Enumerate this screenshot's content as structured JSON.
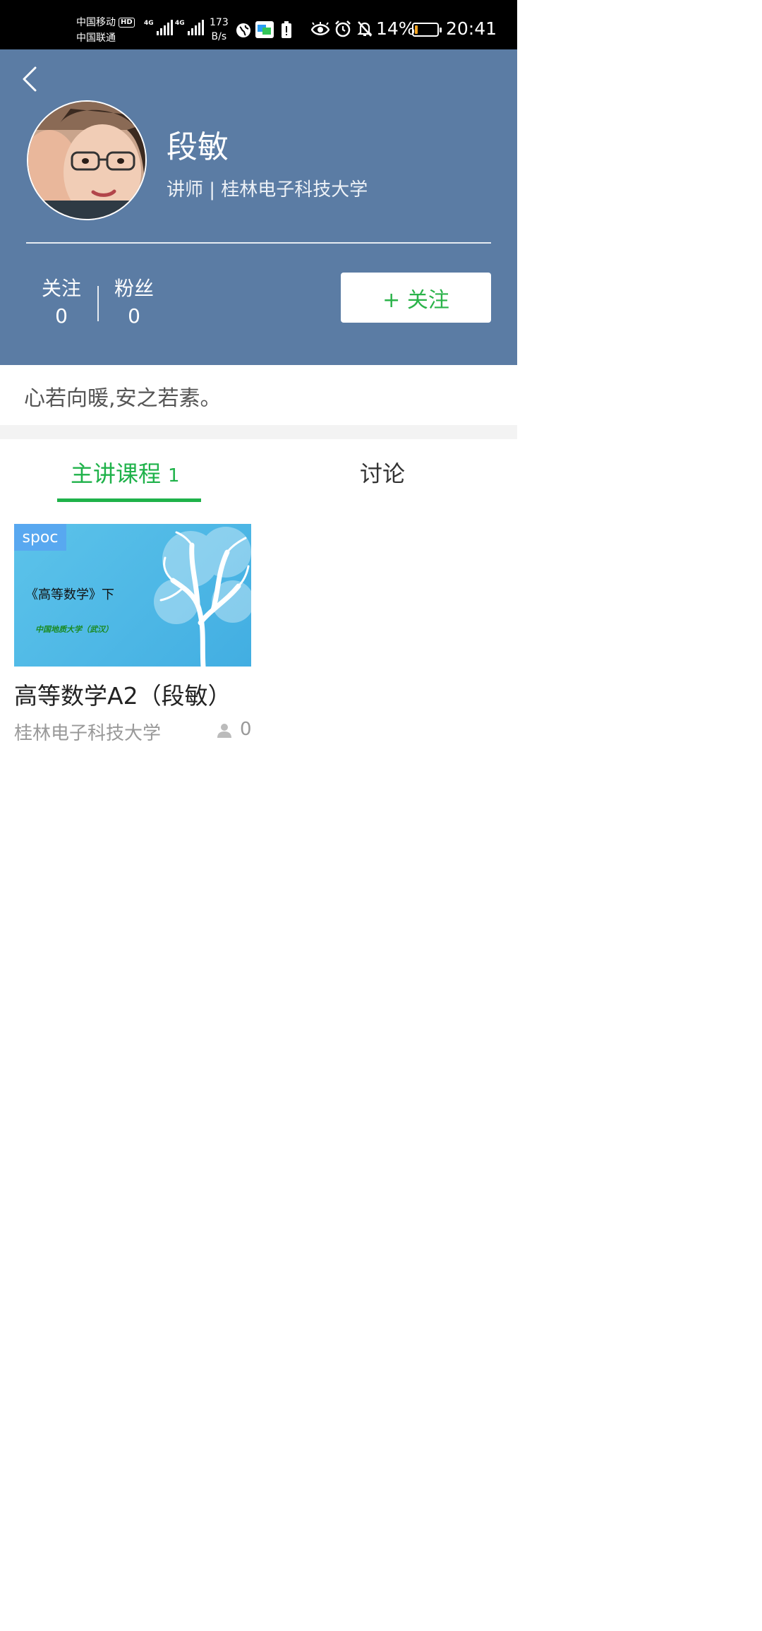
{
  "status_bar": {
    "carrier_1": "中国移动",
    "hd_badge": "HD",
    "carrier_2": "中国联通",
    "network_1": "4G",
    "network_2": "4G",
    "speed_value": "173",
    "speed_unit": "B/s",
    "battery_percent": "14%",
    "battery_level": 0.14,
    "time": "20:41",
    "icons": [
      "globe-icon",
      "news-app-icon",
      "battery-alert-icon",
      "eye-icon",
      "alarm-icon",
      "bell-off-icon"
    ]
  },
  "header": {
    "back_icon": "chevron-left-icon",
    "name": "段敏",
    "subtitle": "讲师 | 桂林电子科技大学",
    "stats": {
      "following_label": "关注",
      "following_count": "0",
      "fans_label": "粉丝",
      "fans_count": "0"
    },
    "follow_button_label": "+ 关注"
  },
  "motto": "心若向暖,安之若素。",
  "tabs": {
    "courses_label": "主讲课程",
    "courses_count": "1",
    "discussion_label": "讨论",
    "active": "courses"
  },
  "courses": [
    {
      "badge": "spoc",
      "thumbnail_title": "《高等数学》下",
      "thumbnail_subtitle": "中国地质大学（武汉）",
      "title": "高等数学A2（段敏）",
      "school": "桂林电子科技大学",
      "learners": "0"
    }
  ],
  "colors": {
    "header_bg": "#5b7ca4",
    "accent_green": "#1fb24a",
    "spoc_badge": "#58a8f0"
  }
}
